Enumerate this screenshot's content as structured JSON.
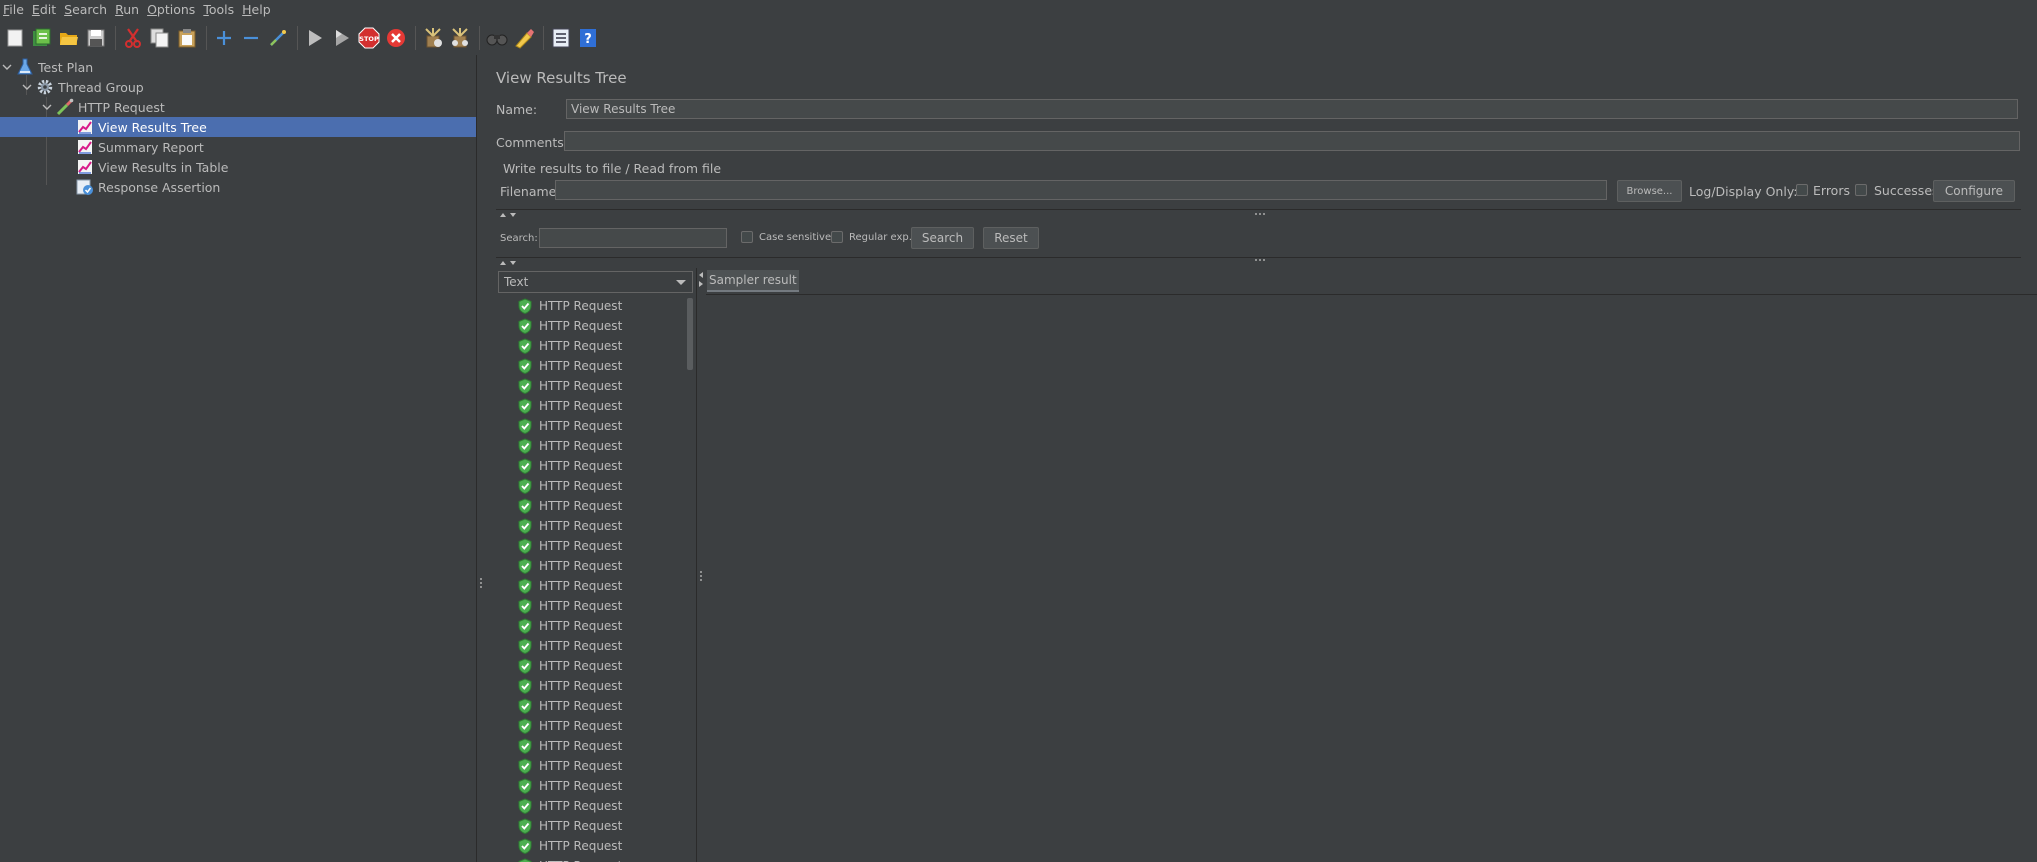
{
  "menu": [
    {
      "label": "File",
      "mnemonic": "F",
      "rest": "ile"
    },
    {
      "label": "Edit",
      "mnemonic": "E",
      "rest": "dit"
    },
    {
      "label": "Search",
      "mnemonic": "S",
      "rest": "earch"
    },
    {
      "label": "Run",
      "mnemonic": "R",
      "rest": "un"
    },
    {
      "label": "Options",
      "mnemonic": "O",
      "rest": "ptions"
    },
    {
      "label": "Tools",
      "mnemonic": "T",
      "rest": "ools"
    },
    {
      "label": "Help",
      "mnemonic": "H",
      "rest": "elp"
    }
  ],
  "toolbar": {
    "icons": [
      "new-icon",
      "templates-icon",
      "open-icon",
      "save-icon",
      "cut-icon",
      "copy-icon",
      "paste-icon",
      "expand-icon",
      "collapse-icon",
      "toggle-icon",
      "start-icon",
      "start-no-pauses-icon",
      "stop-icon",
      "shutdown-icon",
      "clear-icon",
      "clear-all-icon",
      "search-icon",
      "reset-search-icon",
      "function-helper-icon",
      "help-icon"
    ],
    "stop_label": "STOP"
  },
  "tree": {
    "items": [
      {
        "label": "Test Plan",
        "icon": "test-plan-icon",
        "level": 0,
        "expanded": true,
        "selected": false
      },
      {
        "label": "Thread Group",
        "icon": "gear-icon",
        "level": 1,
        "expanded": true,
        "selected": false
      },
      {
        "label": "HTTP Request",
        "icon": "pipette-icon",
        "level": 2,
        "expanded": true,
        "selected": false
      },
      {
        "label": "View Results Tree",
        "icon": "chart-icon",
        "level": 3,
        "selected": true
      },
      {
        "label": "Summary Report",
        "icon": "chart-icon",
        "level": 3,
        "selected": false
      },
      {
        "label": "View Results in Table",
        "icon": "chart-icon",
        "level": 3,
        "selected": false
      },
      {
        "label": "Response Assertion",
        "icon": "assertion-icon",
        "level": 3,
        "selected": false
      }
    ]
  },
  "panel": {
    "title": "View Results Tree",
    "name_label": "Name:",
    "name_value": "View Results Tree",
    "comments_label": "Comments:",
    "comments_value": "",
    "file_group_label": "Write results to file / Read from file",
    "filename_label": "Filename",
    "filename_value": "",
    "browse_label": "Browse...",
    "log_display_label": "Log/Display Only:",
    "errors_label": "Errors",
    "successes_label": "Successes",
    "configure_label": "Configure",
    "search_label": "Search:",
    "search_value": "",
    "case_sensitive_label": "Case sensitive",
    "regular_exp_label": "Regular exp.",
    "search_button_label": "Search",
    "reset_button_label": "Reset",
    "renderer_value": "Text",
    "result_tab_label": "Sampler result"
  },
  "results": {
    "status": "success",
    "items": [
      "HTTP Request",
      "HTTP Request",
      "HTTP Request",
      "HTTP Request",
      "HTTP Request",
      "HTTP Request",
      "HTTP Request",
      "HTTP Request",
      "HTTP Request",
      "HTTP Request",
      "HTTP Request",
      "HTTP Request",
      "HTTP Request",
      "HTTP Request",
      "HTTP Request",
      "HTTP Request",
      "HTTP Request",
      "HTTP Request",
      "HTTP Request",
      "HTTP Request",
      "HTTP Request",
      "HTTP Request",
      "HTTP Request",
      "HTTP Request",
      "HTTP Request",
      "HTTP Request",
      "HTTP Request",
      "HTTP Request",
      "HTTP Request"
    ]
  },
  "colors": {
    "background": "#3c3f41",
    "text": "#bbbbbb",
    "selection": "#4b6eaf",
    "success": "#4caf50"
  }
}
